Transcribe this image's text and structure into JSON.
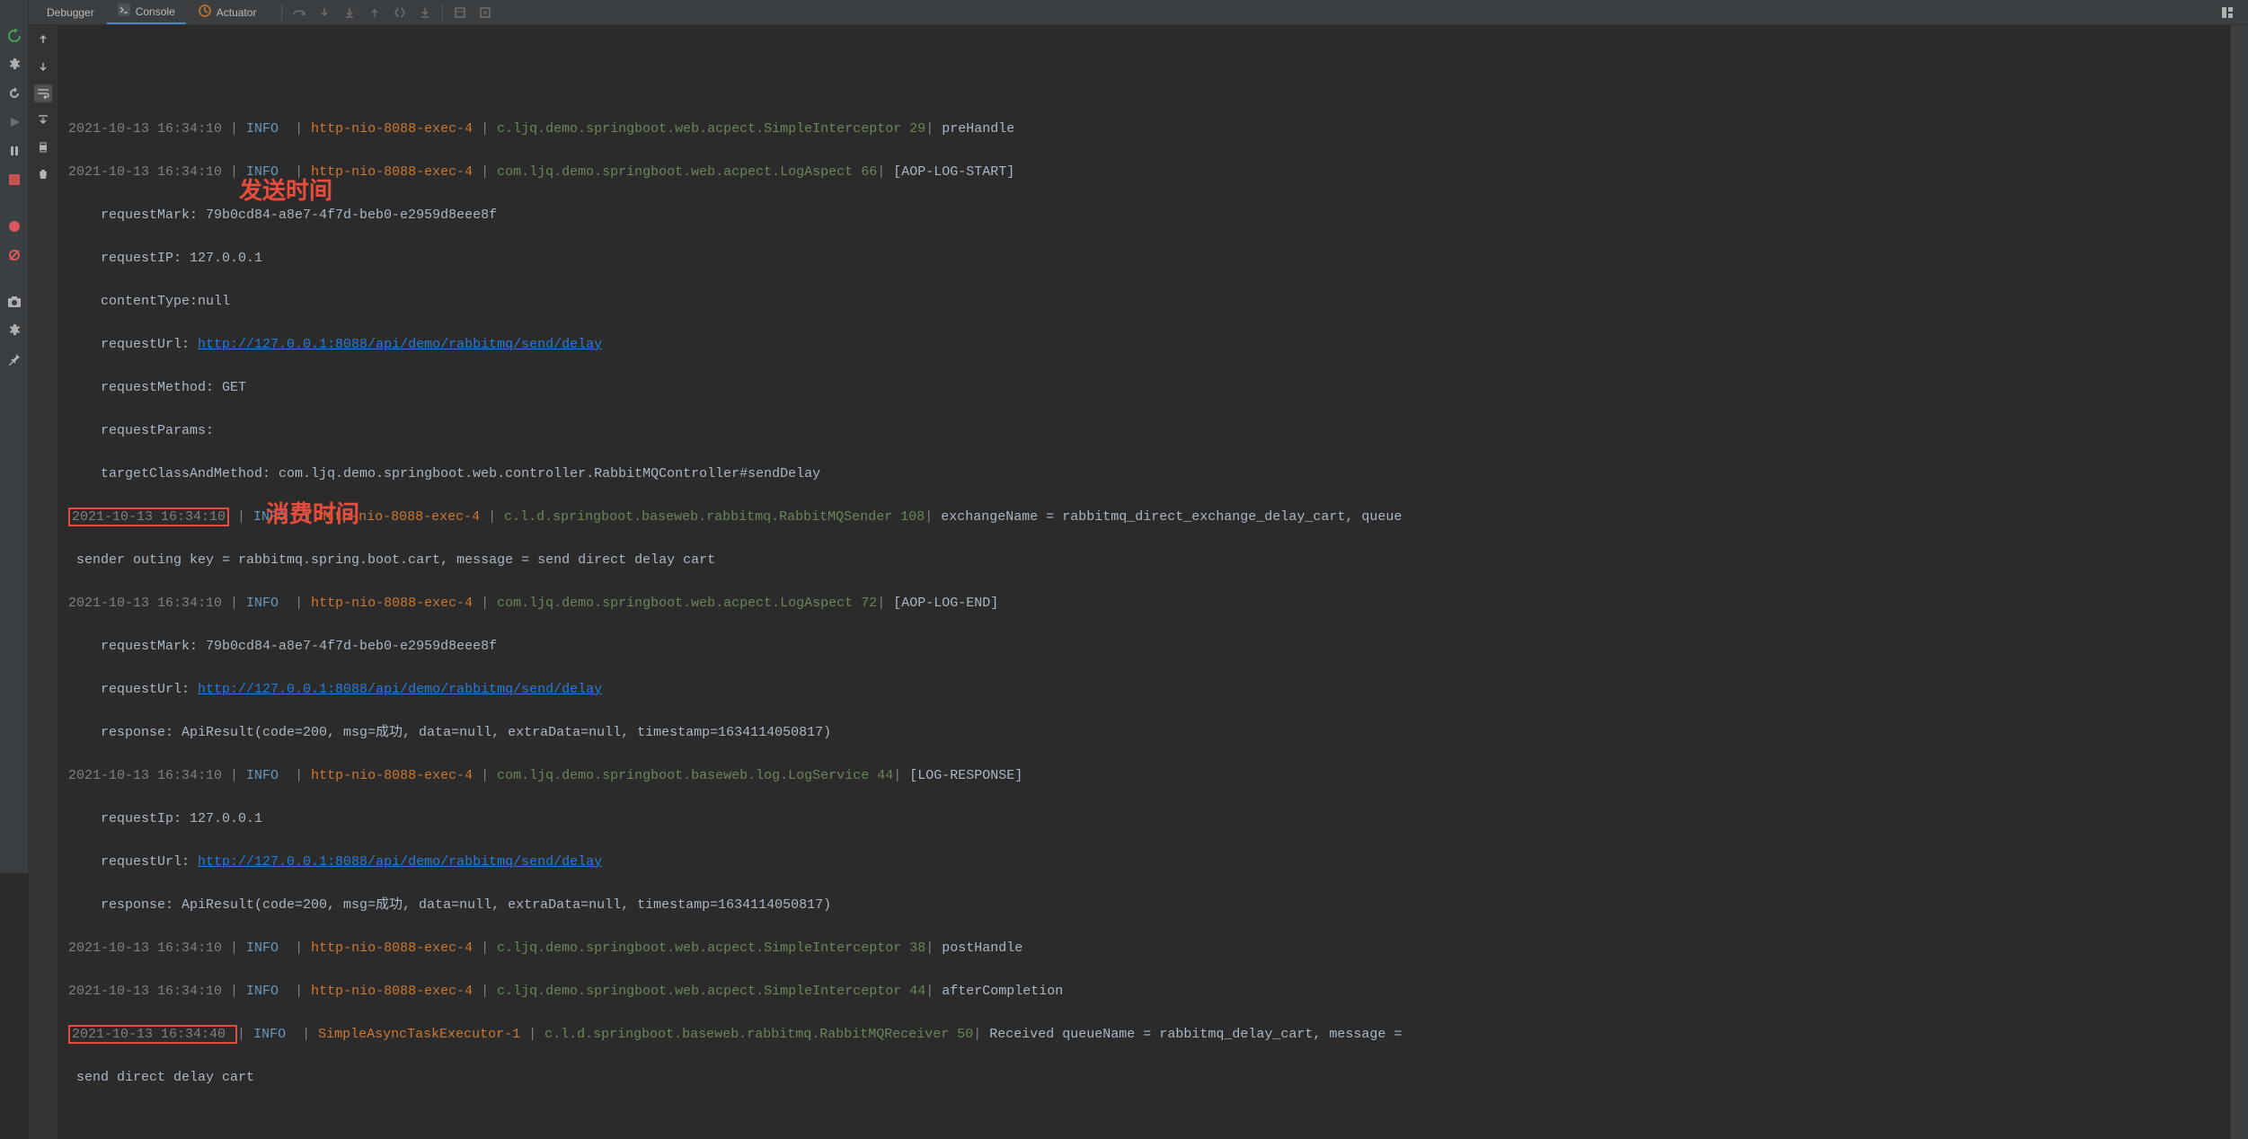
{
  "tabs": {
    "debugger": "Debugger",
    "console": "Console",
    "actuator": "Actuator"
  },
  "annotations": {
    "send_time": "发送时间",
    "consume_time": "消费时间"
  },
  "log": {
    "l1": {
      "ts": "2021-10-13 16:34:10",
      "level": "INFO",
      "thread": "http-nio-8088-exec-4",
      "cls": "c.ljq.demo.springboot.web.acpect.SimpleInterceptor",
      "num": "29",
      "msg": "preHandle"
    },
    "l2": {
      "ts": "2021-10-13 16:34:10",
      "level": "INFO",
      "thread": "http-nio-8088-exec-4",
      "cls": "com.ljq.demo.springboot.web.acpect.LogAspect",
      "num": "66",
      "msg": "[AOP-LOG-START]"
    },
    "l3": "    requestMark: 79b0cd84-a8e7-4f7d-beb0-e2959d8eee8f",
    "l4": "    requestIP: 127.0.0.1",
    "l5": "    contentType:null",
    "l6a": "    requestUrl: ",
    "l6b": "http://127.0.0.1:8088/api/demo/rabbitmq/send/delay",
    "l7": "    requestMethod: GET",
    "l8": "    requestParams:",
    "l9": "    targetClassAndMethod: com.ljq.demo.springboot.web.controller.RabbitMQController#sendDelay",
    "l10": {
      "ts": "2021-10-13 16:34:10",
      "level": "INFO",
      "thread": "http-nio-8088-exec-4",
      "cls": "c.l.d.springboot.baseweb.rabbitmq.RabbitMQSender",
      "num": "108",
      "msg": "exchangeName = rabbitmq_direct_exchange_delay_cart, queue"
    },
    "l10b": " sender outing key = rabbitmq.spring.boot.cart, message = send direct delay cart",
    "l11": {
      "ts": "2021-10-13 16:34:10",
      "level": "INFO",
      "thread": "http-nio-8088-exec-4",
      "cls": "com.ljq.demo.springboot.web.acpect.LogAspect",
      "num": "72",
      "msg": "[AOP-LOG-END]"
    },
    "l12": "    requestMark: 79b0cd84-a8e7-4f7d-beb0-e2959d8eee8f",
    "l13a": "    requestUrl: ",
    "l13b": "http://127.0.0.1:8088/api/demo/rabbitmq/send/delay",
    "l14": "    response: ApiResult(code=200, msg=成功, data=null, extraData=null, timestamp=1634114050817)",
    "l15": {
      "ts": "2021-10-13 16:34:10",
      "level": "INFO",
      "thread": "http-nio-8088-exec-4",
      "cls": "com.ljq.demo.springboot.baseweb.log.LogService",
      "num": "44",
      "msg": "[LOG-RESPONSE]"
    },
    "l16": "    requestIp: 127.0.0.1",
    "l17a": "    requestUrl: ",
    "l17b": "http://127.0.0.1:8088/api/demo/rabbitmq/send/delay",
    "l18": "    response: ApiResult(code=200, msg=成功, data=null, extraData=null, timestamp=1634114050817)",
    "l19": {
      "ts": "2021-10-13 16:34:10",
      "level": "INFO",
      "thread": "http-nio-8088-exec-4",
      "cls": "c.ljq.demo.springboot.web.acpect.SimpleInterceptor",
      "num": "38",
      "msg": "postHandle"
    },
    "l20": {
      "ts": "2021-10-13 16:34:10",
      "level": "INFO",
      "thread": "http-nio-8088-exec-4",
      "cls": "c.ljq.demo.springboot.web.acpect.SimpleInterceptor",
      "num": "44",
      "msg": "afterCompletion"
    },
    "l21": {
      "ts": "2021-10-13 16:34:40",
      "level": "INFO",
      "thread": "SimpleAsyncTaskExecutor-1",
      "cls": "c.l.d.springboot.baseweb.rabbitmq.RabbitMQReceiver",
      "num": "50",
      "msg": "Received queueName = rabbitmq_delay_cart, message ="
    },
    "l21b": " send direct delay cart"
  }
}
